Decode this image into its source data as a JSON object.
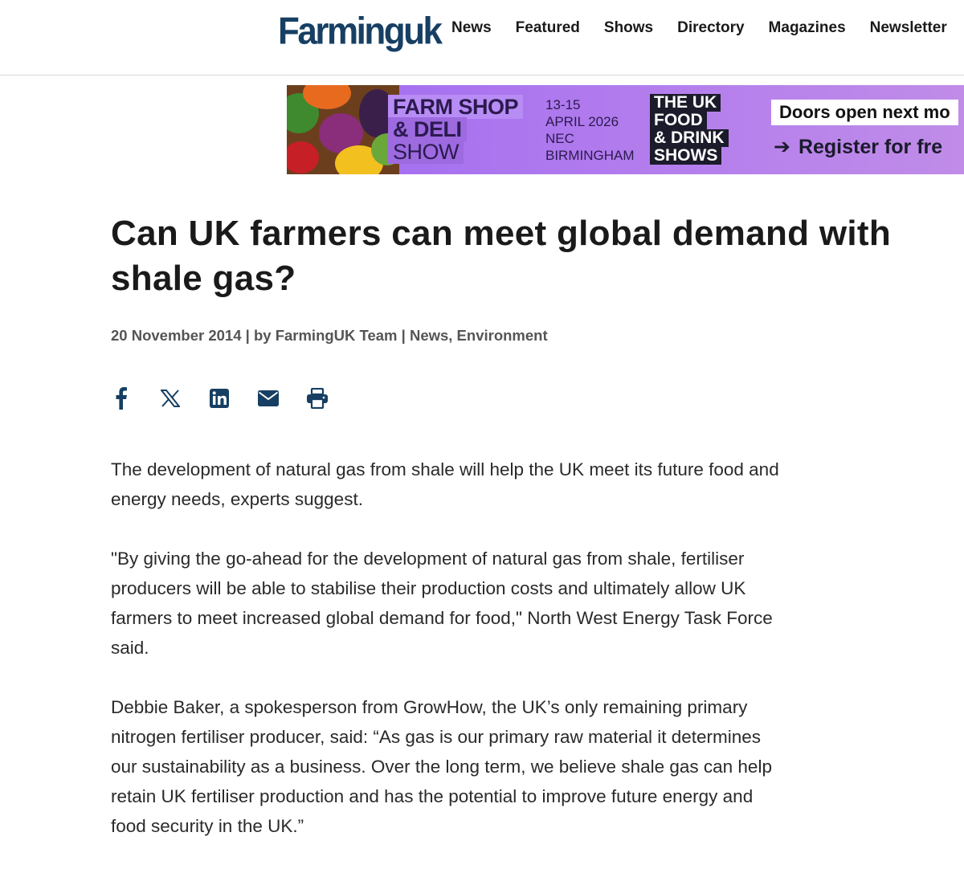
{
  "site": {
    "logo_text": "Farminguk",
    "brand_color": "#173f63"
  },
  "nav": {
    "items": [
      "News",
      "Featured",
      "Shows",
      "Directory",
      "Magazines",
      "Newsletter"
    ]
  },
  "banner": {
    "farm_shop": [
      "FARM SHOP",
      "& DELI",
      "SHOW"
    ],
    "dates": [
      "13-15",
      "APRIL 2026",
      "NEC",
      "BIRMINGHAM"
    ],
    "uk_food": [
      "THE UK",
      "FOOD",
      "& DRINK",
      "SHOWS"
    ],
    "doors": "Doors open next mo",
    "register": "Register for fre"
  },
  "article": {
    "headline": "Can UK farmers can meet global demand with shale gas?",
    "date": "20 November 2014",
    "author": "FarmingUK Team",
    "categories": "News, Environment",
    "share_icons": [
      "facebook-icon",
      "x-icon",
      "linkedin-icon",
      "email-icon",
      "print-icon"
    ],
    "paragraphs": [
      "The development of natural gas from shale will help the UK meet its future food and energy needs, experts suggest.",
      "\"By giving the go-ahead for the development of natural gas from shale, fertiliser producers will be able to stabilise their production costs and ultimately allow UK farmers to meet increased global demand for food,\" North West Energy Task Force said.",
      "Debbie Baker, a spokesperson from GrowHow, the UK’s only remaining primary nitrogen fertiliser producer, said: “As gas is our primary raw material it determines our sustainability as a business. Over the long term, we believe shale gas can help retain UK fertiliser production and has the potential to improve future energy and food security in the UK.”"
    ]
  }
}
